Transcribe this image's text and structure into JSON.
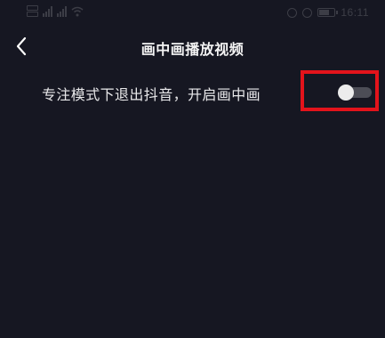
{
  "status_bar": {
    "time": "16:11"
  },
  "header": {
    "title": "画中画播放视频"
  },
  "setting": {
    "label": "专注模式下退出抖音，开启画中画",
    "toggle_state": "off"
  },
  "colors": {
    "background": "#161722",
    "text": "#e8e8ea",
    "toggle_track": "#4c4d56",
    "toggle_knob": "#ececec",
    "highlight": "#e3131b"
  }
}
